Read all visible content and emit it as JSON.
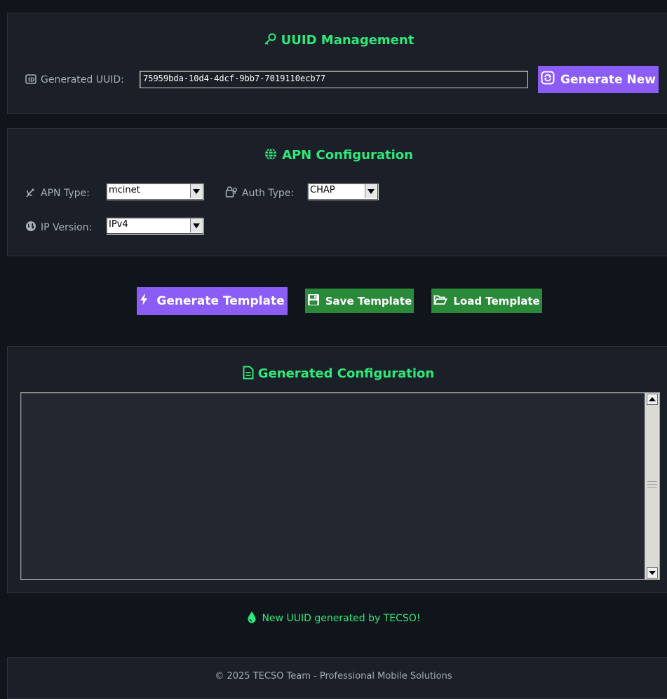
{
  "uuid_panel": {
    "title": "UUID Management",
    "title_icon": "key-icon",
    "uuid_label": "Generated UUID:",
    "uuid_label_icon": "id-card-icon",
    "uuid_value": "75959bda-10d4-4dcf-9bb7-7019110ecb77",
    "generate_button": "Generate New",
    "generate_button_icon": "refresh-icon"
  },
  "apn_panel": {
    "title": "APN Configuration",
    "title_icon": "globe-icon",
    "apn_type_label": "APN Type:",
    "apn_type_icon": "satellite-dish-icon",
    "apn_type_value": "mcinet",
    "auth_type_label": "Auth Type:",
    "auth_type_icon": "lock-icon",
    "auth_type_value": "CHAP",
    "ip_version_label": "IP Version:",
    "ip_version_icon": "earth-icon",
    "ip_version_value": "IPv4"
  },
  "actions": {
    "generate_template": "Generate Template",
    "generate_template_icon": "bolt-icon",
    "save_template": "Save Template",
    "save_template_icon": "floppy-icon",
    "load_template": "Load Template",
    "load_template_icon": "folder-open-icon"
  },
  "output_panel": {
    "title": "Generated Configuration",
    "title_icon": "document-icon",
    "content": ""
  },
  "status": {
    "message": "New UUID generated by TECSO!",
    "icon": "droplet-icon"
  },
  "footer": {
    "text": "© 2025 TECSO Team - Professional Mobile Solutions"
  },
  "colors": {
    "background": "#10141b",
    "panel": "#1b1f27",
    "accent_green": "#2ee87a",
    "button_purple": "#8b5cf6",
    "button_green": "#2a8a3a"
  }
}
